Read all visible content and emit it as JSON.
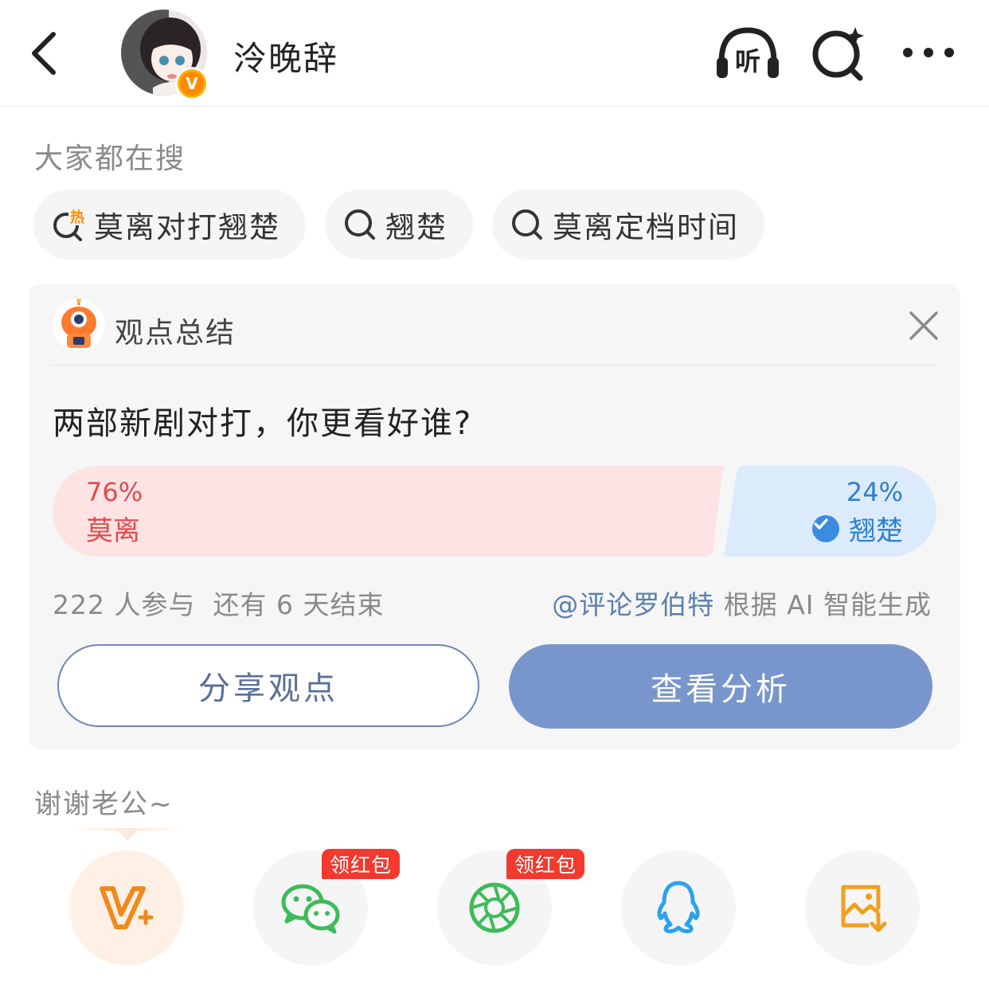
{
  "header": {
    "user_name": "泠晚辞",
    "listen_label": "听"
  },
  "trending": {
    "title": "大家都在搜",
    "hot_badge": "热",
    "chips": [
      {
        "label": "莫离对打翘楚",
        "hot": true
      },
      {
        "label": "翘楚",
        "hot": false
      },
      {
        "label": "莫离定档时间",
        "hot": false
      }
    ]
  },
  "card": {
    "title": "观点总结",
    "question": "两部新剧对打，你更看好谁?",
    "poll": {
      "option_a": {
        "percent_label": "76%",
        "label": "莫离",
        "share": 0.76,
        "color": "#e04b4b"
      },
      "option_b": {
        "percent_label": "24%",
        "label": "翘楚",
        "share": 0.24,
        "color": "#2e7fd0",
        "selected": true
      }
    },
    "participants": "222 人参与",
    "remaining": "还有 6 天结束",
    "source_account": "@评论罗伯特",
    "source_note": "根据 AI 智能生成",
    "share_button": "分享观点",
    "analysis_button": "查看分析"
  },
  "footer": {
    "caption": "谢谢老公~",
    "share_targets": [
      {
        "icon": "vplus-icon",
        "color": "#f08a1c"
      },
      {
        "icon": "wechat-icon",
        "color": "#3dbb5a",
        "tag": "领红包"
      },
      {
        "icon": "moments-icon",
        "color": "#3dbb5a",
        "tag": "领红包"
      },
      {
        "icon": "qq-icon",
        "color": "#2aa2ef"
      },
      {
        "icon": "save-image-icon",
        "color": "#f0a020"
      }
    ]
  }
}
